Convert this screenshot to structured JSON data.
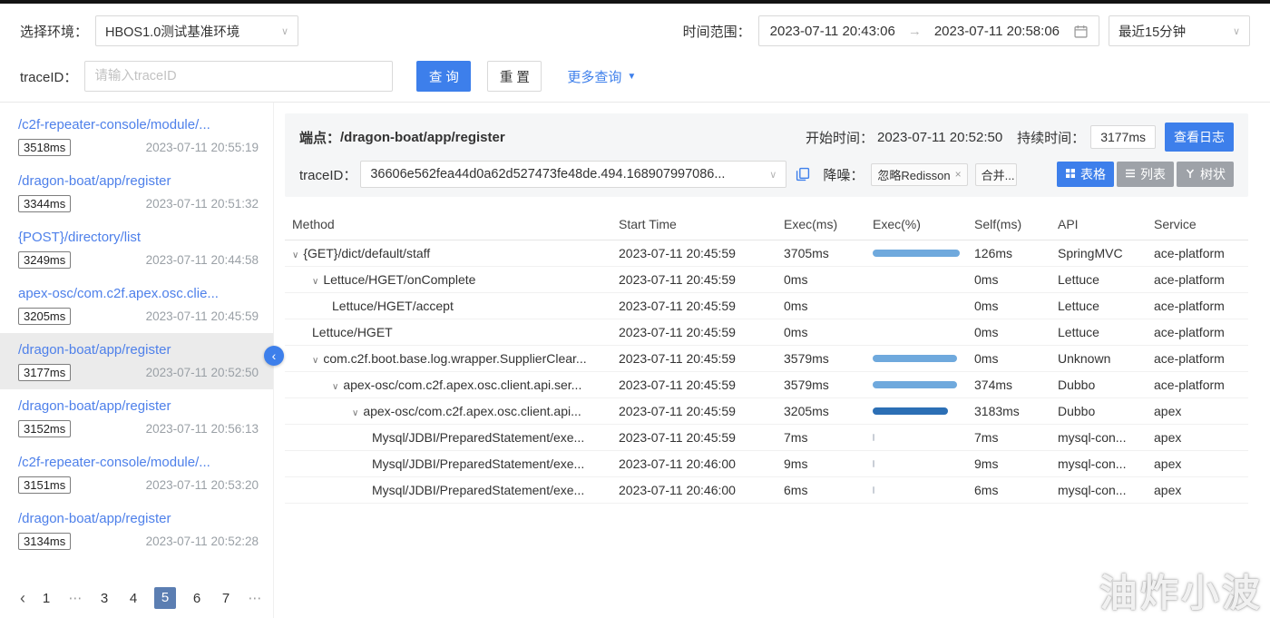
{
  "icons": {
    "chevron_down": "∨",
    "arrow_right": "→",
    "dropdown_arrow": "▼",
    "caret": "∨",
    "collapse_left": "‹"
  },
  "filters": {
    "env_label": "选择环境：",
    "env_value": "HBOS1.0测试基准环境",
    "time_label": "时间范围：",
    "time_start": "2023-07-11 20:43:06",
    "time_end": "2023-07-11 20:58:06",
    "time_preset": "最近15分钟",
    "trace_label": "traceID：",
    "trace_placeholder": "请输入traceID",
    "query_button": "查 询",
    "reset_button": "重 置",
    "more_query_link": "更多查询"
  },
  "sidebar": {
    "items": [
      {
        "path": "/c2f-repeater-console/module/...",
        "duration": "3518ms",
        "time": "2023-07-11 20:55:19",
        "selected": false
      },
      {
        "path": "/dragon-boat/app/register",
        "duration": "3344ms",
        "time": "2023-07-11 20:51:32",
        "selected": false
      },
      {
        "path": "{POST}/directory/list",
        "duration": "3249ms",
        "time": "2023-07-11 20:44:58",
        "selected": false
      },
      {
        "path": "apex-osc/com.c2f.apex.osc.clie...",
        "duration": "3205ms",
        "time": "2023-07-11 20:45:59",
        "selected": false
      },
      {
        "path": "/dragon-boat/app/register",
        "duration": "3177ms",
        "time": "2023-07-11 20:52:50",
        "selected": true
      },
      {
        "path": "/dragon-boat/app/register",
        "duration": "3152ms",
        "time": "2023-07-11 20:56:13",
        "selected": false
      },
      {
        "path": "/c2f-repeater-console/module/...",
        "duration": "3151ms",
        "time": "2023-07-11 20:53:20",
        "selected": false
      },
      {
        "path": "/dragon-boat/app/register",
        "duration": "3134ms",
        "time": "2023-07-11 20:52:28",
        "selected": false
      }
    ],
    "pagination": {
      "prev": "‹",
      "pages": [
        {
          "label": "1"
        },
        {
          "label": "⋯",
          "ellipsis": true
        },
        {
          "label": "3"
        },
        {
          "label": "4"
        },
        {
          "label": "5",
          "active": true
        },
        {
          "label": "6"
        },
        {
          "label": "7"
        },
        {
          "label": "⋯",
          "ellipsis": true
        }
      ]
    }
  },
  "detail": {
    "endpoint_label": "端点：",
    "endpoint_value": "/dragon-boat/app/register",
    "start_time_label": "开始时间：",
    "start_time_value": "2023-07-11 20:52:50",
    "duration_label": "持续时间：",
    "duration_value": "3177ms",
    "view_log_button": "查看日志",
    "trace_label": "traceID：",
    "trace_value": "36606e562fea44d0a62d527473fe48de.494.168907997086...",
    "noise_label": "降噪：",
    "noise_tag1": "忽略Redisson",
    "noise_tag1_close": "×",
    "noise_tag2": "合并...",
    "view_table_label": "表格",
    "view_list_label": "列表",
    "view_tree_label": "树状"
  },
  "table": {
    "columns": [
      "Method",
      "Start Time",
      "Exec(ms)",
      "Exec(%)",
      "Self(ms)",
      "API",
      "Service"
    ],
    "rows": [
      {
        "method": "{GET}/dict/default/staff",
        "indent": 0,
        "caret": true,
        "start": "2023-07-11 20:45:59",
        "exec": "3705ms",
        "bar_pct": 100,
        "bar_color": "#6FA9DD",
        "self": "126ms",
        "api": "SpringMVC",
        "service": "ace-platform"
      },
      {
        "method": "Lettuce/HGET/onComplete",
        "indent": 1,
        "caret": true,
        "start": "2023-07-11 20:45:59",
        "exec": "0ms",
        "bar_pct": 0,
        "bar_color": "",
        "self": "0ms",
        "api": "Lettuce",
        "service": "ace-platform"
      },
      {
        "method": "Lettuce/HGET/accept",
        "indent": 2,
        "caret": false,
        "start": "2023-07-11 20:45:59",
        "exec": "0ms",
        "bar_pct": 0,
        "bar_color": "",
        "self": "0ms",
        "api": "Lettuce",
        "service": "ace-platform"
      },
      {
        "method": "Lettuce/HGET",
        "indent": 1,
        "caret": false,
        "start": "2023-07-11 20:45:59",
        "exec": "0ms",
        "bar_pct": 0,
        "bar_color": "",
        "self": "0ms",
        "api": "Lettuce",
        "service": "ace-platform"
      },
      {
        "method": "com.c2f.boot.base.log.wrapper.SupplierClear...",
        "indent": 1,
        "caret": true,
        "start": "2023-07-11 20:45:59",
        "exec": "3579ms",
        "bar_pct": 96.6,
        "bar_color": "#6FA9DD",
        "self": "0ms",
        "api": "Unknown",
        "service": "ace-platform"
      },
      {
        "method": "apex-osc/com.c2f.apex.osc.client.api.ser...",
        "indent": 2,
        "caret": true,
        "start": "2023-07-11 20:45:59",
        "exec": "3579ms",
        "bar_pct": 96.6,
        "bar_color": "#6FA9DD",
        "self": "374ms",
        "api": "Dubbo",
        "service": "ace-platform"
      },
      {
        "method": "apex-osc/com.c2f.apex.osc.client.api...",
        "indent": 3,
        "caret": true,
        "start": "2023-07-11 20:45:59",
        "exec": "3205ms",
        "bar_pct": 86.5,
        "bar_color": "#2C6FB5",
        "self": "3183ms",
        "api": "Dubbo",
        "service": "apex"
      },
      {
        "method": "Mysql/JDBI/PreparedStatement/exe...",
        "indent": 4,
        "caret": false,
        "start": "2023-07-11 20:45:59",
        "exec": "7ms",
        "bar_pct": 0.5,
        "bar_color": "#C9CED6",
        "self": "7ms",
        "api": "mysql-con...",
        "service": "apex"
      },
      {
        "method": "Mysql/JDBI/PreparedStatement/exe...",
        "indent": 4,
        "caret": false,
        "start": "2023-07-11 20:46:00",
        "exec": "9ms",
        "bar_pct": 0.5,
        "bar_color": "#C9CED6",
        "self": "9ms",
        "api": "mysql-con...",
        "service": "apex"
      },
      {
        "method": "Mysql/JDBI/PreparedStatement/exe...",
        "indent": 4,
        "caret": false,
        "start": "2023-07-11 20:46:00",
        "exec": "6ms",
        "bar_pct": 0.5,
        "bar_color": "#C9CED6",
        "self": "6ms",
        "api": "mysql-con...",
        "service": "apex"
      }
    ]
  },
  "watermark": "油炸小波",
  "colors": {
    "primary_blue": "#3D7FEB",
    "link_blue": "#4E80EA",
    "gray_button": "#9EA2A8",
    "pagination_active": "#5B7EB2",
    "bar_light": "#6FA9DD",
    "bar_dark": "#2C6FB5",
    "bar_tick": "#C9CED6"
  }
}
